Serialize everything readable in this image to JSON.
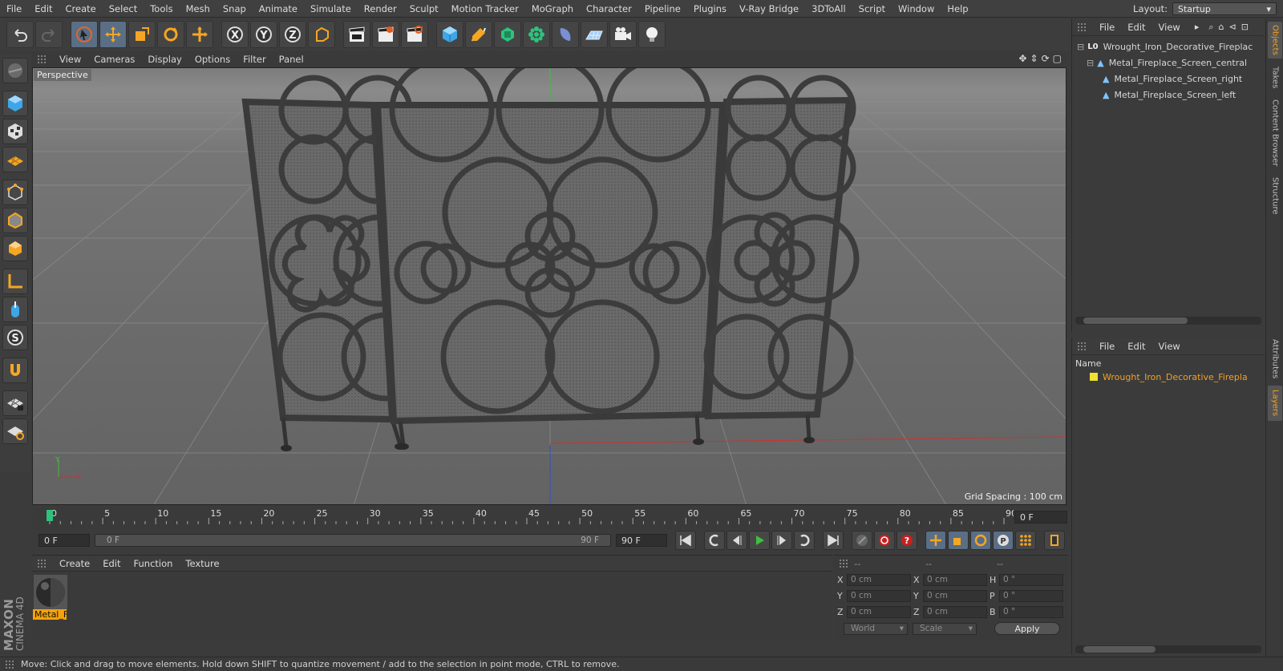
{
  "menu": [
    "File",
    "Edit",
    "Create",
    "Select",
    "Tools",
    "Mesh",
    "Snap",
    "Animate",
    "Simulate",
    "Render",
    "Sculpt",
    "Motion Tracker",
    "MoGraph",
    "Character",
    "Pipeline",
    "Plugins",
    "V-Ray Bridge",
    "3DToAll",
    "Script",
    "Window",
    "Help"
  ],
  "layout": {
    "label": "Layout:",
    "value": "Startup"
  },
  "viewport": {
    "menu": [
      "View",
      "Cameras",
      "Display",
      "Options",
      "Filter",
      "Panel"
    ],
    "camera_label": "Perspective",
    "grid_spacing": "Grid Spacing : 100 cm",
    "axis_y": "Y",
    "axis_x": "X"
  },
  "timeline": {
    "ticks": [
      "0",
      "5",
      "10",
      "15",
      "20",
      "25",
      "30",
      "35",
      "40",
      "45",
      "50",
      "55",
      "60",
      "65",
      "70",
      "75",
      "80",
      "85",
      "90"
    ],
    "current_frame": "0 F",
    "start_field": "0 F",
    "range_start": "0 F",
    "range_end": "90 F",
    "end_field": "90 F"
  },
  "material_panel": {
    "menu": [
      "Create",
      "Edit",
      "Function",
      "Texture"
    ],
    "material_name": "Metal_F"
  },
  "coordinates": {
    "headers": [
      "--",
      "--",
      "--"
    ],
    "rows": [
      {
        "a": "X",
        "av": "0 cm",
        "b": "X",
        "bv": "0 cm",
        "c": "H",
        "cv": "0 °"
      },
      {
        "a": "Y",
        "av": "0 cm",
        "b": "Y",
        "bv": "0 cm",
        "c": "P",
        "cv": "0 °"
      },
      {
        "a": "Z",
        "av": "0 cm",
        "b": "Z",
        "bv": "0 cm",
        "c": "B",
        "cv": "0 °"
      }
    ],
    "mode": "World",
    "scale_mode": "Scale",
    "apply": "Apply"
  },
  "objects_panel": {
    "menu": [
      "File",
      "Edit",
      "View"
    ],
    "items": [
      {
        "name": "Wrought_Iron_Decorative_Fireplac",
        "level": 0
      },
      {
        "name": "Metal_Fireplace_Screen_central",
        "level": 1
      },
      {
        "name": "Metal_Fireplace_Screen_right",
        "level": 2
      },
      {
        "name": "Metal_Fireplace_Screen_left",
        "level": 2
      }
    ]
  },
  "layers_panel": {
    "menu": [
      "File",
      "Edit",
      "View"
    ],
    "column": "Name",
    "item": "Wrought_Iron_Decorative_Firepla"
  },
  "side_tabs": [
    "Objects",
    "Takes",
    "Content Browser",
    "Structure",
    "Attributes",
    "Layers"
  ],
  "status": "Move: Click and drag to move elements. Hold down SHIFT to quantize movement / add to the selection in point mode, CTRL to remove.",
  "brand": {
    "line1": "MAXON",
    "line2": "CINEMA 4D"
  },
  "colors": {
    "accent": "#f4a20b",
    "selection": "#5a6e85",
    "y_axis": "#3ec03e",
    "x_axis": "#d03030",
    "z_axis": "#3050d0"
  }
}
